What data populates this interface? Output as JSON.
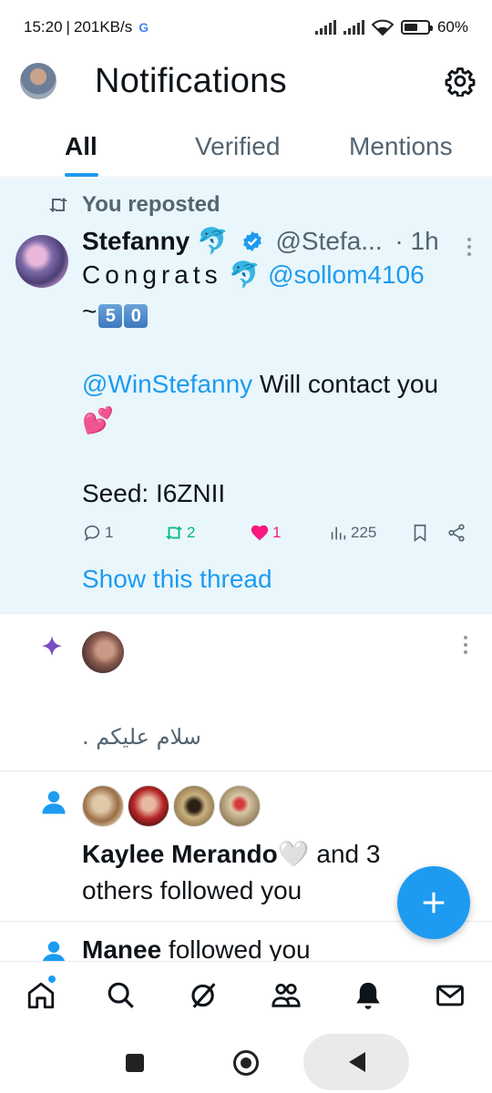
{
  "status": {
    "time": "15:20",
    "speed": "201KB/s",
    "g_mark": "G",
    "battery": "60%",
    "battery_level": 0.6
  },
  "header": {
    "title": "Notifications"
  },
  "tabs": [
    {
      "label": "All",
      "active": true
    },
    {
      "label": "Verified",
      "active": false
    },
    {
      "label": "Mentions",
      "active": false
    }
  ],
  "notif1": {
    "context": "You reposted",
    "author_name": "Stefanny",
    "author_emoji": "🐬",
    "handle": "@Stefa...",
    "time": "· 1h",
    "line1_text": "Congrats",
    "line1_emoji": "🐬",
    "line1_mention": "@sollom4106",
    "line2_prefix": "~",
    "keycap1": "5",
    "keycap2": "0",
    "line3_mention": "@WinStefanny",
    "line3_text": " Will contact you",
    "line4_emoji": "💕",
    "line5": "Seed: I6ZNII",
    "replies": "1",
    "reposts": "2",
    "likes": "1",
    "views": "225",
    "show_thread": "Show this thread"
  },
  "notif2": {
    "text": "سلام عليكم ."
  },
  "notif3": {
    "name": "Kaylee Merando",
    "emoji": "🤍",
    "text": " and 3 others followed you"
  },
  "notif4": {
    "name": "Manee",
    "text": " followed you"
  },
  "colors": {
    "accent": "#1d9bf0",
    "like": "#f91880",
    "repost": "#00ba7c",
    "highlight_bg": "#e9f6fb"
  }
}
